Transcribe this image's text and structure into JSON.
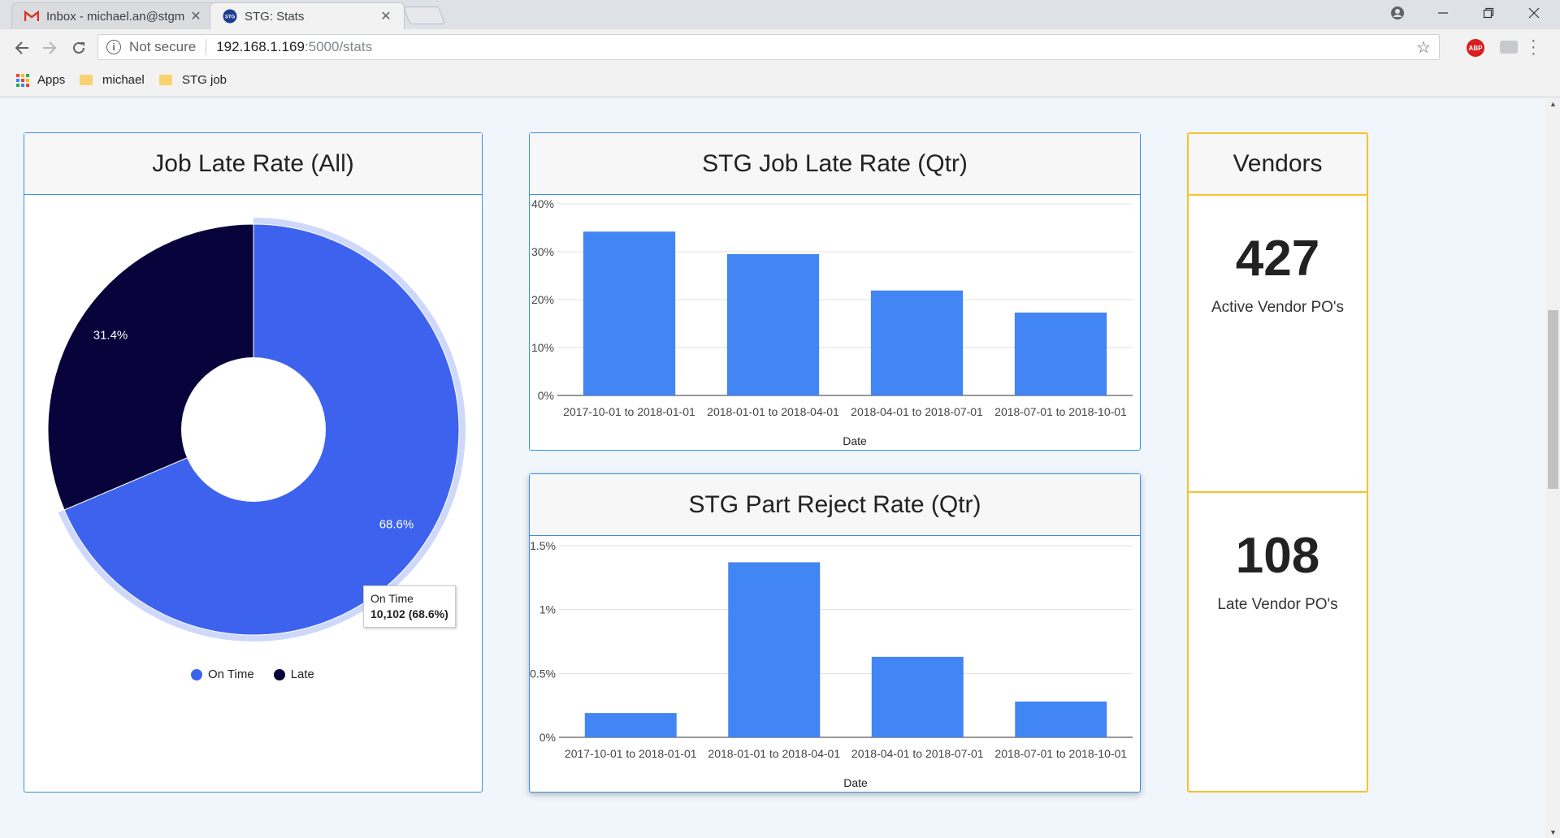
{
  "browser": {
    "tabs": [
      {
        "title": "Inbox - michael.an@stgm",
        "favicon": "gmail-icon",
        "active": false
      },
      {
        "title": "STG: Stats",
        "favicon": "stg-icon",
        "active": true
      }
    ],
    "address": {
      "security": "Not secure",
      "host": "192.168.1.169",
      "path": ":5000/stats"
    },
    "bookmarks": [
      {
        "label": "Apps",
        "icon": "apps-grid-icon"
      },
      {
        "label": "michael",
        "icon": "folder-icon"
      },
      {
        "label": "STG job",
        "icon": "folder-icon"
      }
    ]
  },
  "dashboard": {
    "job_late_rate": {
      "title": "Job Late Rate (All)",
      "tooltip": {
        "label": "On Time",
        "value": "10,102 (68.6%)"
      },
      "legend": [
        "On Time",
        "Late"
      ]
    },
    "stg_job_late": {
      "title": "STG Job Late Rate (Qtr)"
    },
    "stg_part_reject": {
      "title": "STG Part Reject Rate (Qtr)"
    },
    "vendors": {
      "title": "Vendors",
      "active_count": "427",
      "active_label": "Active Vendor PO's",
      "late_count": "108",
      "late_label": "Late Vendor PO's"
    }
  },
  "chart_data": [
    {
      "type": "pie",
      "title": "Job Late Rate (All)",
      "categories": [
        "On Time",
        "Late"
      ],
      "values": [
        68.6,
        31.4
      ],
      "labels": [
        "68.6%",
        "31.4%"
      ],
      "colors": [
        "#3d63ee",
        "#08033a"
      ],
      "legend": "bottom"
    },
    {
      "type": "bar",
      "title": "STG Job Late Rate (Qtr)",
      "categories": [
        "2017-10-01 to 2018-01-01",
        "2018-01-01 to 2018-04-01",
        "2018-04-01 to 2018-07-01",
        "2018-07-01 to 2018-10-01"
      ],
      "values": [
        34.2,
        29.5,
        21.9,
        17.3
      ],
      "xlabel": "Date",
      "ylabel": "",
      "ylim": [
        0,
        40
      ],
      "yticks": [
        0,
        10,
        20,
        30,
        40
      ],
      "ytick_labels": [
        "0%",
        "10%",
        "20%",
        "30%",
        "40%"
      ],
      "color": "#4285f4",
      "grid": true
    },
    {
      "type": "bar",
      "title": "STG Part Reject Rate (Qtr)",
      "categories": [
        "2017-10-01 to 2018-01-01",
        "2018-01-01 to 2018-04-01",
        "2018-04-01 to 2018-07-01",
        "2018-07-01 to 2018-10-01"
      ],
      "values": [
        0.19,
        1.37,
        0.63,
        0.28
      ],
      "xlabel": "Date",
      "ylabel": "",
      "ylim": [
        0,
        1.5
      ],
      "yticks": [
        0,
        0.5,
        1,
        1.5
      ],
      "ytick_labels": [
        "0%",
        "0.5%",
        "1%",
        "1.5%"
      ],
      "color": "#4285f4",
      "grid": true
    }
  ]
}
